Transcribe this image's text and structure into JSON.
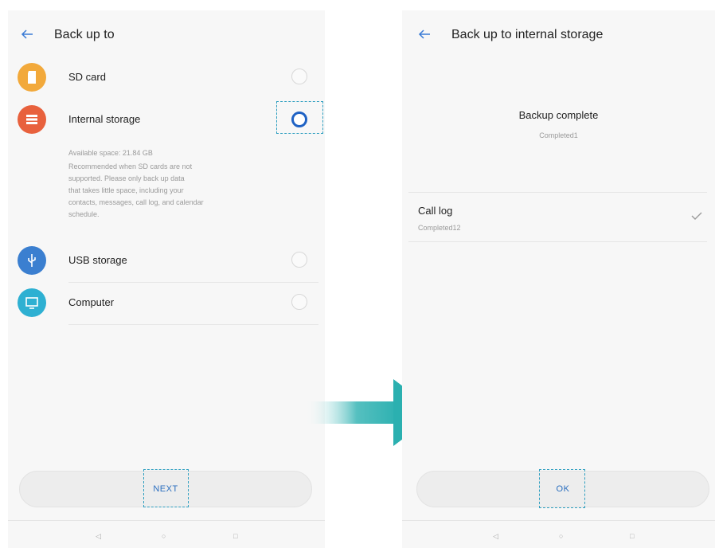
{
  "left_screen": {
    "title": "Back up to",
    "options": [
      {
        "label": "SD card",
        "icon": "sd-card-icon",
        "color": "#f2a93b",
        "selected": false
      },
      {
        "label": "Internal storage",
        "icon": "storage-icon",
        "color": "#e8613d",
        "selected": true
      },
      {
        "label": "USB storage",
        "icon": "usb-icon",
        "color": "#3b7fd0",
        "selected": false
      },
      {
        "label": "Computer",
        "icon": "computer-icon",
        "color": "#2eb0d2",
        "selected": false
      }
    ],
    "internal_storage_desc": {
      "available": "Available space: 21.84 GB",
      "line1": "Recommended when SD cards are not",
      "line2": "supported. Please only back up data",
      "line3": "that takes little space, including your",
      "line4": "contacts, messages, call log, and calendar",
      "line5": "schedule."
    },
    "next_button": "NEXT"
  },
  "right_screen": {
    "title": "Back up to internal storage",
    "status_title": "Backup complete",
    "status_sub": "Completed1",
    "item": {
      "label": "Call log",
      "sub": "Completed12"
    },
    "ok_button": "OK"
  },
  "navbar": {
    "back": "◁",
    "home": "○",
    "recent": "□"
  },
  "colors": {
    "accent_blue": "#1f62c4",
    "highlight_dash": "#2f9fc0",
    "arrow_teal": "#2bb0b0"
  }
}
